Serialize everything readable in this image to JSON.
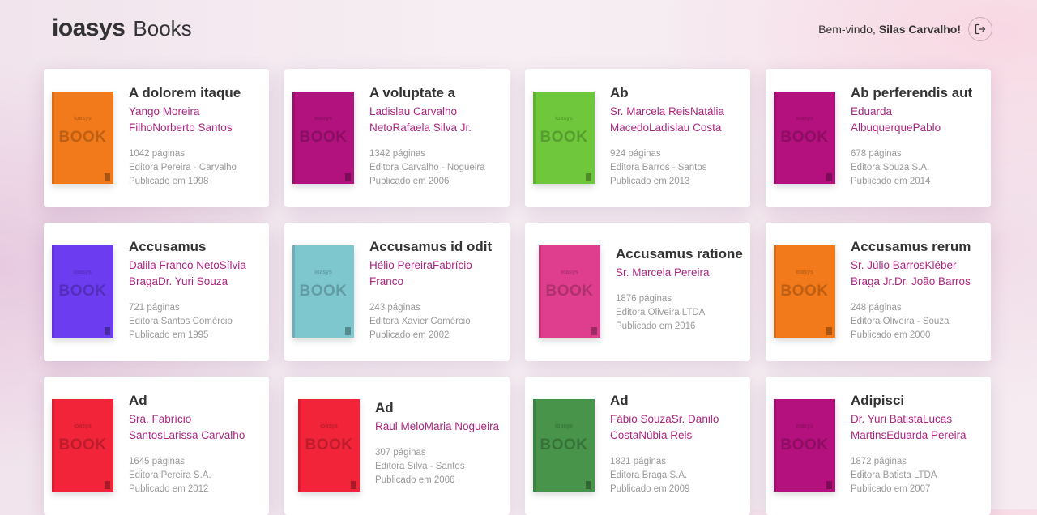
{
  "header": {
    "brand": "ioasys",
    "product": "Books",
    "welcome_prefix": "Bem-vindo,",
    "user_name": "Silas Carvalho!",
    "logout_icon": "logout-arrow-icon"
  },
  "cover": {
    "brand_text": "ioasys",
    "book_text": "BOOK"
  },
  "books": [
    {
      "title": "A dolorem itaque",
      "authors": "Yango Moreira FilhoNorberto Santos",
      "pages": "1042 páginas",
      "publisher": "Editora Pereira - Carvalho",
      "published": "Publicado em 1998",
      "cover_color": "#f27a1a"
    },
    {
      "title": "A voluptate a",
      "authors": "Ladislau Carvalho NetoRafaela Silva Jr.",
      "pages": "1342 páginas",
      "publisher": "Editora Carvalho - Nogueira",
      "published": "Publicado em 2006",
      "cover_color": "#b1127e"
    },
    {
      "title": "Ab",
      "authors": "Sr. Marcela ReisNatália MacedoLadislau Costa",
      "pages": "924 páginas",
      "publisher": "Editora Barros - Santos",
      "published": "Publicado em 2013",
      "cover_color": "#6fc83b"
    },
    {
      "title": "Ab perferendis aut",
      "authors": "Eduarda AlbuquerquePablo SantosOfélia Pereira",
      "pages": "678 páginas",
      "publisher": "Editora Souza S.A.",
      "published": "Publicado em 2014",
      "cover_color": "#b5117e"
    },
    {
      "title": "Accusamus",
      "authors": "Dalila Franco NetoSílvia BragaDr. Yuri Souza",
      "pages": "721 páginas",
      "publisher": "Editora Santos Comércio",
      "published": "Publicado em 1995",
      "cover_color": "#6b3cf0"
    },
    {
      "title": "Accusamus id odit",
      "authors": "Hélio PereiraFabrício Franco",
      "pages": "243 páginas",
      "publisher": "Editora Xavier Comércio",
      "published": "Publicado em 2002",
      "cover_color": "#7ec7cf"
    },
    {
      "title": "Accusamus ratione",
      "authors": "Sr. Marcela Pereira",
      "pages": "1876 páginas",
      "publisher": "Editora Oliveira LTDA",
      "published": "Publicado em 2016",
      "cover_color": "#df3e8e"
    },
    {
      "title": "Accusamus rerum",
      "authors": "Sr. Júlio BarrosKléber Braga Jr.Dr. João Barros",
      "pages": "248 páginas",
      "publisher": "Editora Oliveira - Souza",
      "published": "Publicado em 2000",
      "cover_color": "#f27a1a"
    },
    {
      "title": "Ad",
      "authors": "Sra. Fabrício SantosLarissa Carvalho",
      "pages": "1645 páginas",
      "publisher": "Editora Pereira S.A.",
      "published": "Publicado em 2012",
      "cover_color": "#f2243a"
    },
    {
      "title": "Ad",
      "authors": "Raul MeloMaria Nogueira",
      "pages": "307 páginas",
      "publisher": "Editora Silva - Santos",
      "published": "Publicado em 2006",
      "cover_color": "#f2243a"
    },
    {
      "title": "Ad",
      "authors": "Fábio SouzaSr. Danilo CostaNúbia Reis",
      "pages": "1821 páginas",
      "publisher": "Editora Braga S.A.",
      "published": "Publicado em 2009",
      "cover_color": "#47944a"
    },
    {
      "title": "Adipisci",
      "authors": "Dr. Yuri BatistaLucas MartinsEduarda Pereira",
      "pages": "1872 páginas",
      "publisher": "Editora Batista LTDA",
      "published": "Publicado em 2007",
      "cover_color": "#b5117e"
    }
  ]
}
